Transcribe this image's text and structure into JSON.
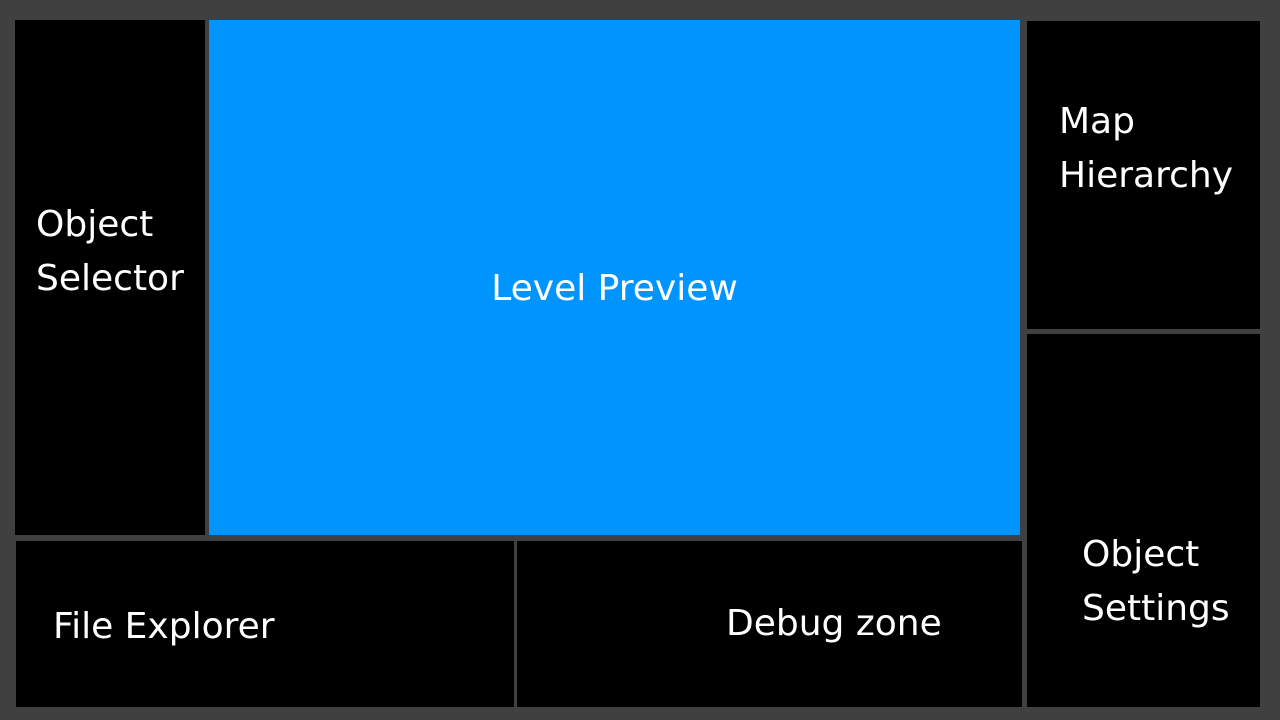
{
  "colors": {
    "background": "#404040",
    "panel": "#000000",
    "preview": "#0094ff",
    "text": "#ffffff"
  },
  "panels": {
    "object_selector": "Object\nSelector",
    "level_preview": "Level Preview",
    "map_hierarchy": "Map\nHierarchy",
    "object_settings": "Object\nSettings",
    "file_explorer": "File Explorer",
    "debug_zone": "Debug zone"
  }
}
